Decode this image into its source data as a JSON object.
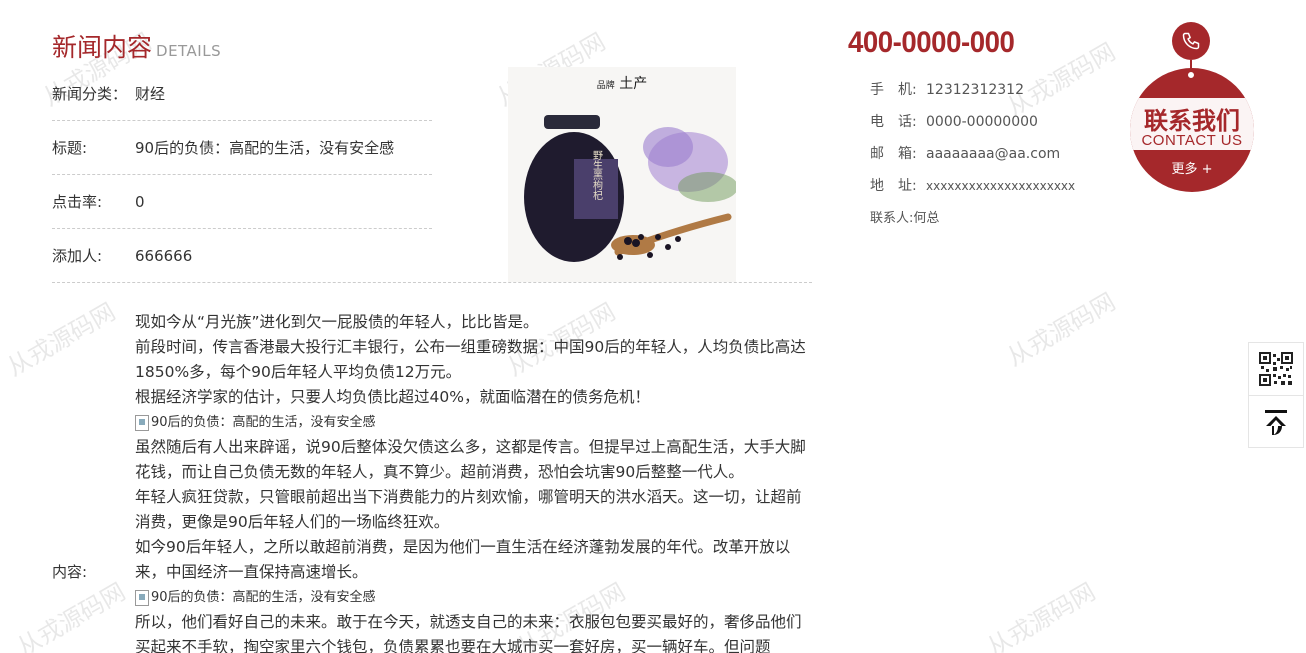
{
  "section": {
    "title_cn": "新闻内容",
    "title_en": "DETAILS"
  },
  "info": {
    "category_label": "新闻分类：",
    "category_value": "财经",
    "title_label": "标题:",
    "title_value": "90后的负债：高配的生活，没有安全感",
    "clicks_label": "点击率:",
    "clicks_value": "0",
    "author_label": "添加人:",
    "author_value": "666666"
  },
  "product_image": {
    "brand": "土产",
    "brand_prefix": "品牌",
    "jar_text": "野生黑枸杞"
  },
  "content_label": "内容:",
  "article": {
    "p1": "现如今从“月光族”进化到欠一屁股债的年轻人，比比皆是。",
    "p2": "前段时间，传言香港最大投行汇丰银行，公布一组重磅数据：中国90后的年轻人，人均负债比高达1850%多，每个90后年轻人平均负债12万元。",
    "p3": "根据经济学家的估计，只要人均负债比超过40%，就面临潜在的债务危机！",
    "img1_alt": "90后的负债：高配的生活，没有安全感",
    "p4": "虽然随后有人出来辟谣，说90后整体没欠债这么多，这都是传言。但提早过上高配生活，大手大脚花钱，而让自己负债无数的年轻人，真不算少。超前消费，恐怕会坑害90后整整一代人。",
    "p5": "年轻人疯狂贷款，只管眼前超出当下消费能力的片刻欢愉，哪管明天的洪水滔天。这一切，让超前消费，更像是90后年轻人们的一场临终狂欢。",
    "p6": "如今90后年轻人，之所以敢超前消费，是因为他们一直生活在经济蓬勃发展的年代。改革开放以来，中国经济一直保持高速增长。",
    "img2_alt": "90后的负债：高配的生活，没有安全感",
    "p7": "所以，他们看好自己的未来。敢于在今天，就透支自己的未来：衣服包包要买最好的，奢侈品他们买起来不手软，掏空家里六个钱包，负债累累也要在大城市买一套好房，买一辆好车。但问题"
  },
  "contact": {
    "hotline": "400-0000-000",
    "mobile_label": "手　机:",
    "mobile": "12312312312",
    "phone_label": "电　话:",
    "phone": "0000-00000000",
    "email_label": "邮　箱:",
    "email": "aaaaaaaa@aa.com",
    "address_label": "地　址:",
    "address": "xxxxxxxxxxxxxxxxxxxxx",
    "person_label": "联系人:",
    "person": "何总"
  },
  "badge": {
    "cn": "联系我们",
    "en": "CONTACT US",
    "more": "更多 +"
  },
  "watermark": "从戎源码网",
  "colors": {
    "accent": "#a5282b"
  },
  "icons": {
    "phone": "phone-icon",
    "qr": "qr-code-icon",
    "top": "back-to-top-icon"
  }
}
